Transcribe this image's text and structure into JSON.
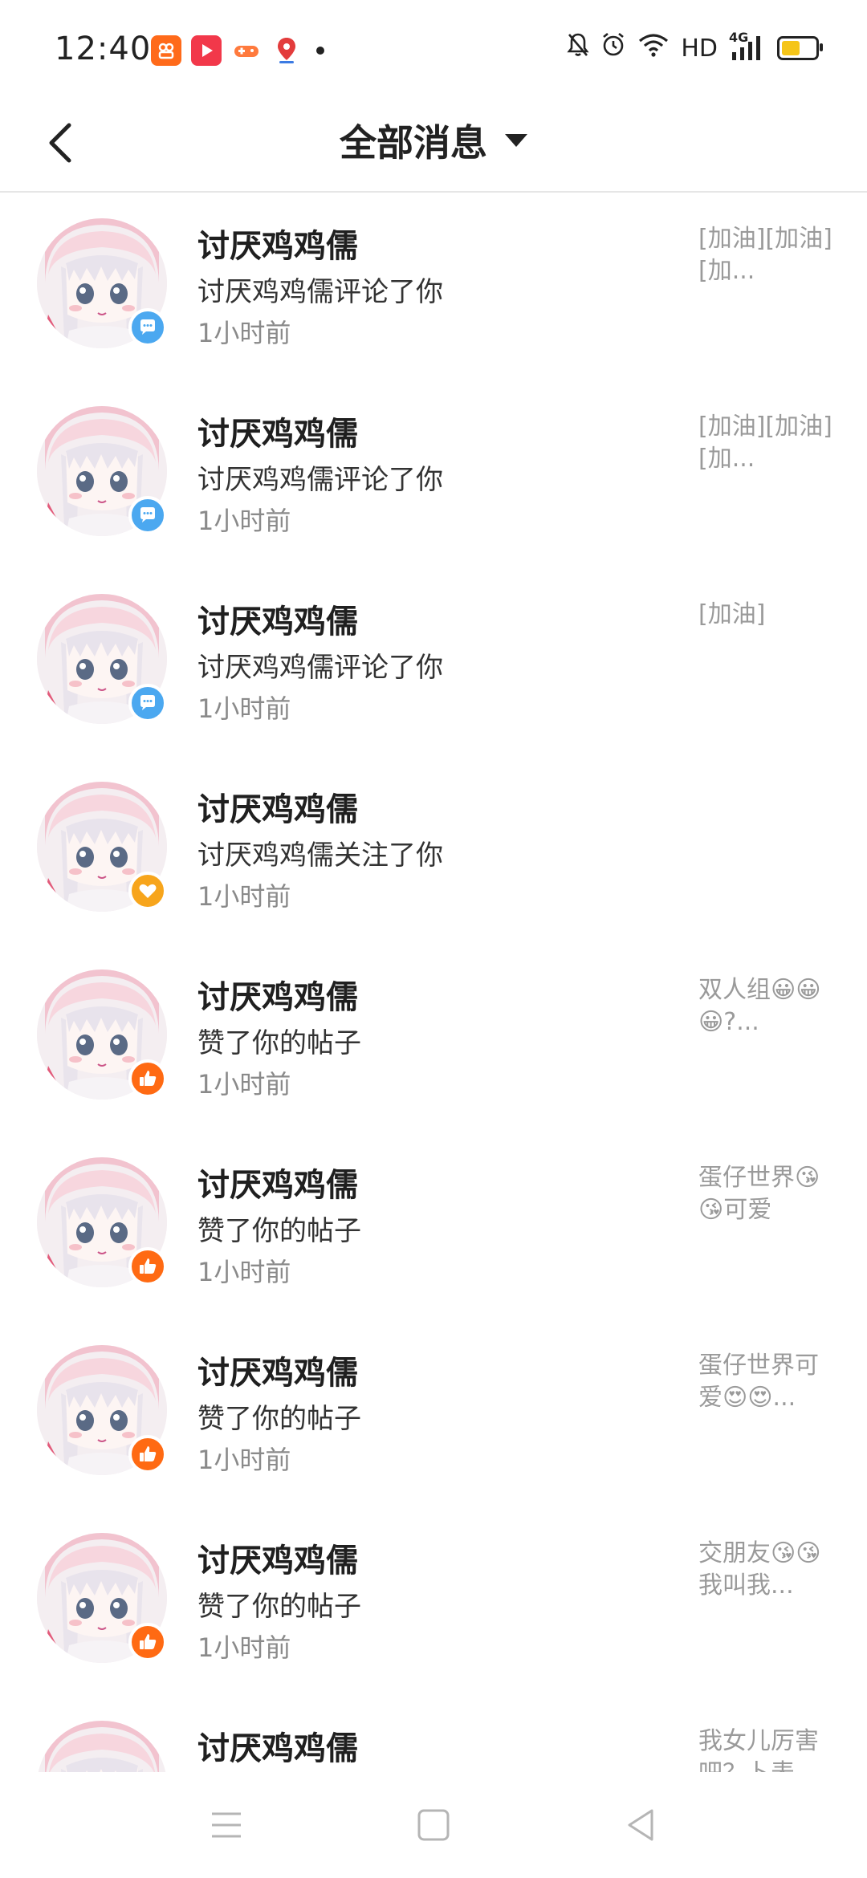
{
  "status_bar": {
    "time": "12:40",
    "network": "HD",
    "signal": "4G",
    "icons": [
      "bell-off-icon",
      "alarm-icon",
      "wifi-icon",
      "signal-icon",
      "battery-icon"
    ],
    "apps": [
      {
        "name": "kuaishou-app-icon",
        "color": "#ff6a1a"
      },
      {
        "name": "video-app-icon",
        "color": "#f2384a"
      },
      {
        "name": "game-app-icon",
        "color": "#ff7a3d"
      },
      {
        "name": "map-app-icon",
        "color": "#e33c3c"
      }
    ],
    "battery_level": 0.5
  },
  "header": {
    "title": "全部消息"
  },
  "messages": [
    {
      "name": "讨厌鸡鸡儒",
      "action": "讨厌鸡鸡儒评论了你",
      "time": "1小时前",
      "preview": "[加油][加油][加...",
      "type": "comment"
    },
    {
      "name": "讨厌鸡鸡儒",
      "action": "讨厌鸡鸡儒评论了你",
      "time": "1小时前",
      "preview": "[加油][加油][加...",
      "type": "comment"
    },
    {
      "name": "讨厌鸡鸡儒",
      "action": "讨厌鸡鸡儒评论了你",
      "time": "1小时前",
      "preview": "[加油]",
      "type": "comment"
    },
    {
      "name": "讨厌鸡鸡儒",
      "action": "讨厌鸡鸡儒关注了你",
      "time": "1小时前",
      "preview": "",
      "type": "follow"
    },
    {
      "name": "讨厌鸡鸡儒",
      "action": "赞了你的帖子",
      "time": "1小时前",
      "preview": "双人组😀😀😀?...",
      "type": "like"
    },
    {
      "name": "讨厌鸡鸡儒",
      "action": "赞了你的帖子",
      "time": "1小时前",
      "preview": "蛋仔世界😘😘可爱",
      "type": "like"
    },
    {
      "name": "讨厌鸡鸡儒",
      "action": "赞了你的帖子",
      "time": "1小时前",
      "preview": "蛋仔世界可爱😍😍...",
      "type": "like"
    },
    {
      "name": "讨厌鸡鸡儒",
      "action": "赞了你的帖子",
      "time": "1小时前",
      "preview": "交朋友😘😘我叫我...",
      "type": "like"
    },
    {
      "name": "讨厌鸡鸡儒",
      "action": "",
      "time": "",
      "preview": "我女儿厉害吧？卜表",
      "type": "like"
    }
  ],
  "badge_colors": {
    "comment": "#4ba8f0",
    "follow": "#f7a51c",
    "like": "#ff6a13"
  },
  "system_nav": [
    "menu-icon",
    "home-icon",
    "back-triangle-icon"
  ]
}
